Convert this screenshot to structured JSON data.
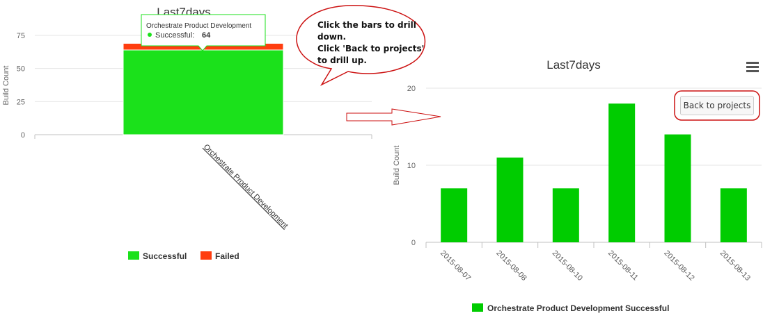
{
  "callout": {
    "line1": "Click the bars to drill",
    "line2": "down.",
    "line3": "Click 'Back to projects'",
    "line4": "to drill up."
  },
  "left_chart": {
    "tooltip": {
      "title": "Orchestrate Product Development",
      "series": "Successful:",
      "value": "64"
    }
  },
  "right_chart": {
    "back_button_label": "Back to projects",
    "menu_icon": "hamburger-menu-icon"
  },
  "colors": {
    "successful_left": "#1be11b",
    "failed": "#ff3d0f",
    "successful_right": "#00cc00",
    "callout_border": "#cc1111",
    "arrow_border": "#cc1111"
  },
  "chart_data": [
    {
      "type": "bar",
      "stacked": true,
      "title": "Last7days",
      "xlabel": "",
      "ylabel": "Build Count",
      "ylim": [
        0,
        75
      ],
      "yticks": [
        "0",
        "25",
        "50",
        "75"
      ],
      "categories": [
        "Orchestrate Product Development"
      ],
      "series": [
        {
          "name": "Successful",
          "values": [
            64
          ]
        },
        {
          "name": "Failed",
          "values": [
            5
          ]
        }
      ],
      "legend": "bottom"
    },
    {
      "type": "bar",
      "title": "Last7days",
      "xlabel": "",
      "ylabel": "Build Count",
      "ylim": [
        0,
        20
      ],
      "yticks": [
        "0",
        "10",
        "20"
      ],
      "categories": [
        "2015-08-07",
        "2015-08-08",
        "2015-08-10",
        "2015-08-11",
        "2015-08-12",
        "2015-08-13"
      ],
      "series": [
        {
          "name": "Orchestrate Product Development Successful",
          "values": [
            7,
            11,
            7,
            18,
            14,
            7
          ]
        }
      ],
      "legend": "bottom"
    }
  ]
}
